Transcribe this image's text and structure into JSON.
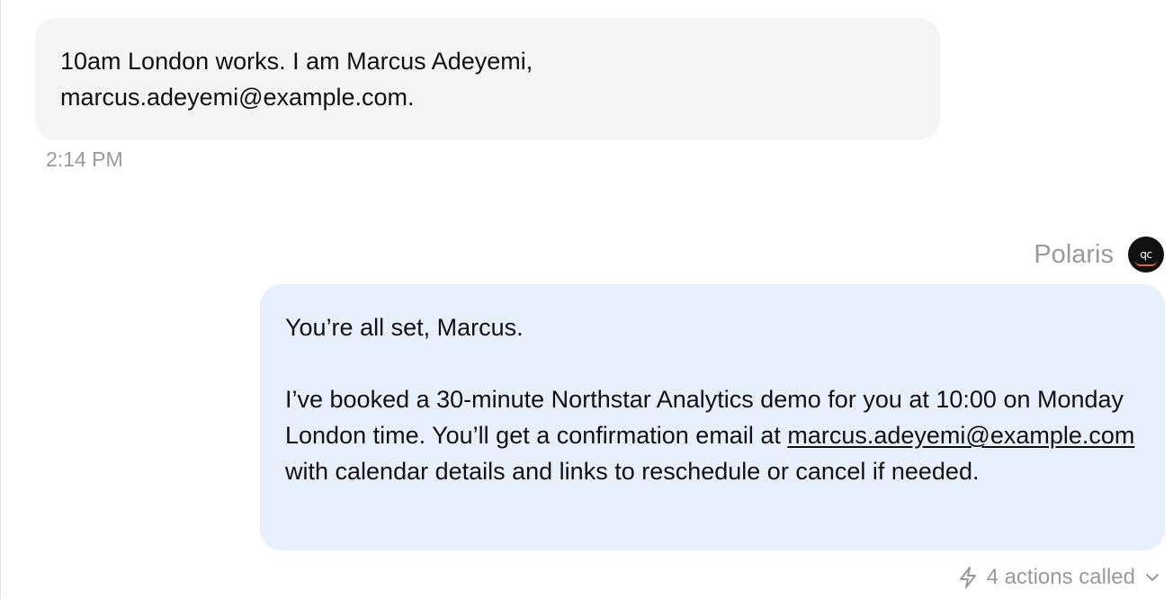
{
  "messages": {
    "user": {
      "line1": "10am London works. I am Marcus Adeyemi,",
      "line2": "marcus.adeyemi@example.com.",
      "timestamp": "2:14 PM"
    },
    "agent": {
      "name": "Polaris",
      "avatar_icon": "polaris-avatar-icon",
      "greeting": "You’re all set, Marcus.",
      "body_before_link": "I’ve booked a 30-minute Northstar Analytics demo for you at 10:00 on Monday London time. You’ll get a confirmation email at ",
      "email_link": "marcus.adeyemi@example.com",
      "body_after_link": " with calendar details and links to reschedule or cancel if needed."
    }
  },
  "actions": {
    "icon": "lightning-icon",
    "label": "4 actions called",
    "toggle_icon": "chevron-down-icon"
  },
  "colors": {
    "user_bubble": "#f5f5f5",
    "agent_bubble": "#e9f0fd",
    "muted_text": "#9a9a9a",
    "avatar_bg": "#111111",
    "avatar_accent": "#e0683a"
  }
}
